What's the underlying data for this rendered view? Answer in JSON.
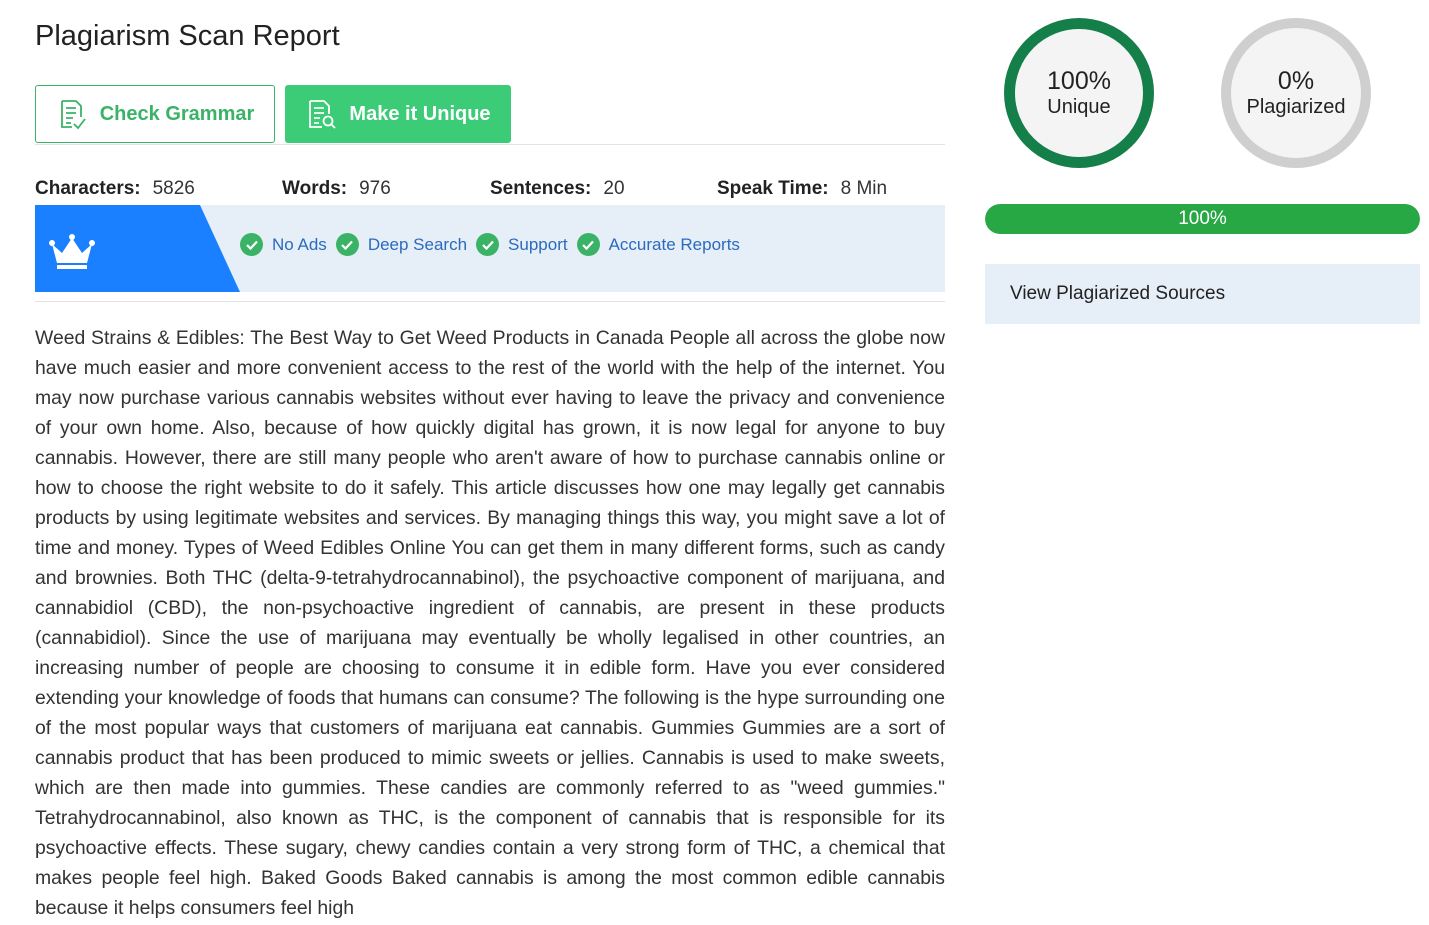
{
  "header": {
    "title": "Plagiarism Scan Report"
  },
  "actions": {
    "grammar_label": "Check Grammar",
    "unique_label": "Make it Unique"
  },
  "stats": [
    {
      "label": "Characters:",
      "value": "5826"
    },
    {
      "label": "Words:",
      "value": "976"
    },
    {
      "label": "Sentences:",
      "value": "20"
    },
    {
      "label": "Speak Time:",
      "value": "8 Min"
    }
  ],
  "promo": {
    "label": "Go Pro",
    "features": [
      "No Ads",
      "Deep Search",
      "Support",
      "Accurate Reports"
    ]
  },
  "article": {
    "text": "Weed Strains & Edibles: The Best Way to Get Weed Products in Canada People all across the globe now have much easier and more convenient access to the rest of the world with the help of the internet. You may now purchase various cannabis websites without ever having to leave the privacy and convenience of your own home. Also, because of how quickly digital has grown, it is now legal for anyone to buy cannabis. However, there are still many people who aren't aware of how to purchase cannabis online or how to choose the right website to do it safely. This article discusses how one may legally get cannabis products by using legitimate websites and services. By managing things this way, you might save a lot of time and money. Types of Weed Edibles Online You can get them in many different forms, such as candy and brownies. Both THC (delta-9-tetrahydrocannabinol), the psychoactive component of marijuana, and cannabidiol (CBD), the non-psychoactive ingredient of cannabis, are present in these products (cannabidiol). Since the use of marijuana may eventually be wholly legalised in other countries, an increasing number of people are choosing to consume it in edible form. Have you ever considered extending your knowledge of foods that humans can consume?  The following is the hype surrounding one of the most popular ways that customers of marijuana eat cannabis.  Gummies Gummies are a sort of cannabis product that has been produced to mimic sweets or jellies. Cannabis is used to make sweets, which are then made into gummies. These candies are commonly referred to as \"weed gummies.\" Tetrahydrocannabinol, also known as THC, is the component of cannabis that is responsible for its psychoactive effects. These sugary, chewy candies contain a very strong form of THC, a chemical that makes people feel high. Baked Goods Baked cannabis is among the most common edible cannabis because it helps consumers feel high"
  },
  "results": {
    "unique_pct": "100%",
    "unique_label": "Unique",
    "plag_pct": "0%",
    "plag_label": "Plagiarized",
    "progress_label": "100%",
    "progress_fraction": 1.0,
    "sources_label": "View Plagiarized Sources"
  },
  "colors": {
    "accent_green": "#3ccb77",
    "unique_ring": "#157f4a",
    "plag_ring": "#cfcfcf",
    "pro_blue": "#1a80ff",
    "progress_green": "#28a745"
  },
  "icons": [
    "grammar-doc-icon",
    "unique-doc-icon",
    "crown-icon",
    "check-circle-icon"
  ]
}
